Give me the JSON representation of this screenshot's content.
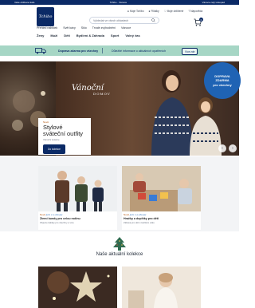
{
  "topbar": {
    "left": "Vaše oblíbené kafe",
    "center": "Tchibo · Vánoce",
    "right": "Vánoce celý Listopad"
  },
  "header": {
    "logo": "Tchibo",
    "search_placeholder": "Vyhledat ve všech oblastech",
    "utility": [
      "Moje Tchibo",
      "Filiálky",
      "Moje oblíbené",
      "Nápověda"
    ],
    "cart_count": "0"
  },
  "nav_secondary": [
    "Přehled nabídek",
    "Svět kávy",
    "Sklo",
    "Trvalé zvýhodnění",
    "Vánoce"
  ],
  "nav_primary": [
    "Ženy",
    "Muži",
    "Děti",
    "Bydlení & Zahrada",
    "Sport",
    "Volný čas"
  ],
  "promo": {
    "strong": "Doprava zdarma pro všechny",
    "light": "Důležité informace o aktuálních opatřeních",
    "button": "Více zde"
  },
  "hero": {
    "script": "Vánoční",
    "script2": "DOMOV",
    "badge": [
      "DOPRAVA",
      "ZDARMA",
      "pro všechny"
    ],
    "card_kicker": "Nově",
    "card_title": "Stylové sváteční outfity",
    "card_sub": "Vánoční kolekce",
    "card_cta": "Do kolekce"
  },
  "tiles": [
    {
      "tag1": "Nově",
      "tag2": "Jen v e-shopu",
      "title": "Zimní bundy pro celou rodinu",
      "sub": "Objevte kabáty pro všechny a více"
    },
    {
      "tag1": "Nově",
      "tag2": "Jen v e-shopu",
      "title": "Hračky a doplňky pro děti",
      "sub": "Zábava pro děti v každém věku"
    }
  ],
  "section": {
    "title": "Naše aktuální kolekce"
  },
  "colors": {
    "navy": "#0b2a66",
    "mint": "#a6d6c5",
    "blue": "#1f63b4"
  }
}
